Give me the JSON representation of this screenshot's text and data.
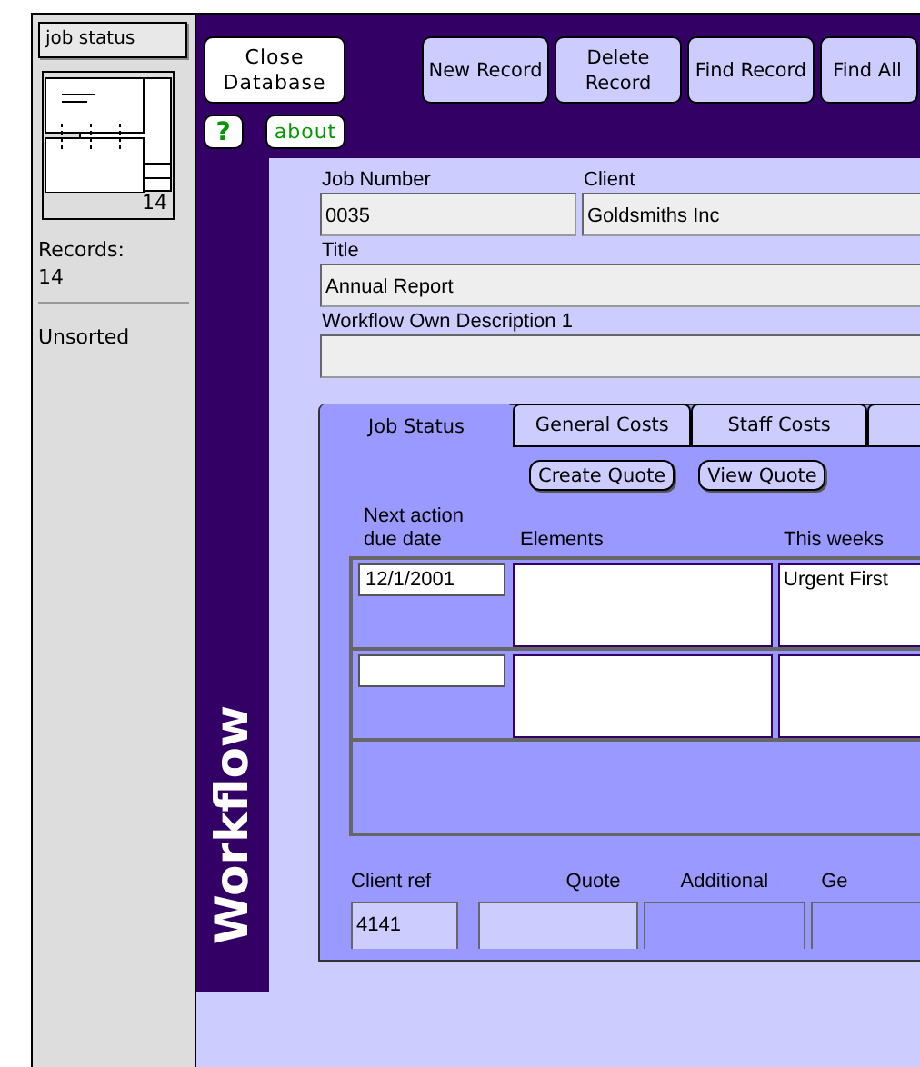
{
  "sidebar": {
    "layout_menu": "job status",
    "book_count": "14",
    "records_label": "Records:",
    "records_count": "14",
    "sort_status": "Unsorted"
  },
  "toolbar": {
    "close_button": "Close Database",
    "help_button": "?",
    "about_button": "about",
    "actions": [
      "New Record",
      "Delete Record",
      "Find Record",
      "Find All"
    ]
  },
  "layout_title": "Workflow",
  "fields": [
    {
      "label": "Job Number",
      "value": "0035"
    },
    {
      "label": "Client",
      "value": "Goldsmiths Inc"
    },
    {
      "label": "Title",
      "value": "Annual Report"
    },
    {
      "label": "Workflow Own Description 1"
    }
  ],
  "tabs": [
    {
      "label": "Job Status",
      "selected": true
    },
    {
      "label": "General Costs",
      "selected": false
    },
    {
      "label": "Staff Costs",
      "selected": false
    },
    {
      "selected": false
    }
  ],
  "quote_buttons": [
    "Create Quote",
    "View Quote"
  ],
  "columns": [
    "Next action due date",
    "Elements",
    "This weeks"
  ],
  "rows": [
    {
      "due_date": "12/1/2001",
      "this_weeks": "Urgent First"
    },
    {}
  ],
  "footer_fields": [
    {
      "label": "Client ref",
      "value": "4141",
      "kind": "light"
    },
    {
      "label": "Quote",
      "kind": "light"
    },
    {
      "label": "Additional",
      "kind": "dim"
    },
    {
      "label": "Ge",
      "kind": "dim"
    }
  ]
}
